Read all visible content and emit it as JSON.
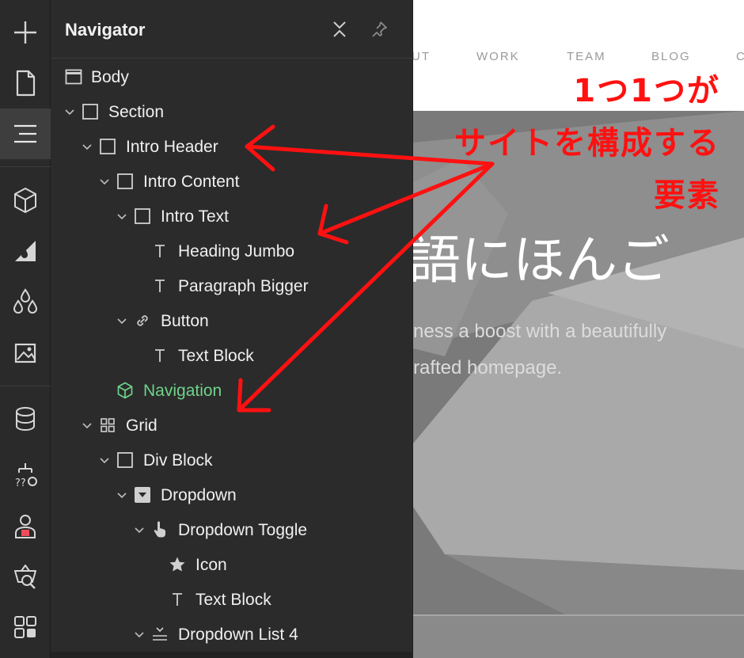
{
  "navigator": {
    "title": "Navigator",
    "tree": [
      {
        "label": "Body",
        "icon": "body-icon",
        "chevron": false
      },
      {
        "label": "Section",
        "icon": "box-icon",
        "chevron": true
      },
      {
        "label": "Intro Header",
        "icon": "box-icon",
        "chevron": true
      },
      {
        "label": "Intro Content",
        "icon": "box-icon",
        "chevron": true
      },
      {
        "label": "Intro Text",
        "icon": "box-icon",
        "chevron": true
      },
      {
        "label": "Heading Jumbo",
        "icon": "text-icon",
        "chevron": false
      },
      {
        "label": "Paragraph Bigger",
        "icon": "text-icon",
        "chevron": false
      },
      {
        "label": "Button",
        "icon": "link-icon",
        "chevron": true
      },
      {
        "label": "Text Block",
        "icon": "text-icon",
        "chevron": false
      },
      {
        "label": "Navigation",
        "icon": "symbol-icon",
        "chevron": false,
        "highlight_color": "#6fd38a"
      },
      {
        "label": "Grid",
        "icon": "grid-icon",
        "chevron": true
      },
      {
        "label": "Div Block",
        "icon": "box-icon",
        "chevron": true
      },
      {
        "label": "Dropdown",
        "icon": "dropdown-icon",
        "chevron": true
      },
      {
        "label": "Dropdown Toggle",
        "icon": "pointer-icon",
        "chevron": true
      },
      {
        "label": "Icon",
        "icon": "star-icon",
        "chevron": false
      },
      {
        "label": "Text Block",
        "icon": "text-icon",
        "chevron": false
      },
      {
        "label": "Dropdown List 4",
        "icon": "list-icon",
        "chevron": true
      }
    ]
  },
  "toolbar": {
    "tools": [
      "add-icon",
      "pages-icon",
      "navigator-icon",
      "components-icon",
      "styles-icon",
      "swatches-icon",
      "assets-icon",
      "cms-icon",
      "logic-icon",
      "users-icon",
      "ecommerce-icon",
      "apps-icon"
    ],
    "active_tool": "navigator-icon"
  },
  "preview": {
    "menu": [
      "UT",
      "WORK",
      "TEAM",
      "BLOG",
      "C"
    ],
    "hero_title": "語にほんご",
    "hero_line1": "ness a boost with a beautifully",
    "hero_line2": "rafted homepage."
  },
  "annotation": {
    "line1": "1つ1つが",
    "line2": "サイトを構成する",
    "line3": "要素",
    "color": "#ff1111"
  }
}
